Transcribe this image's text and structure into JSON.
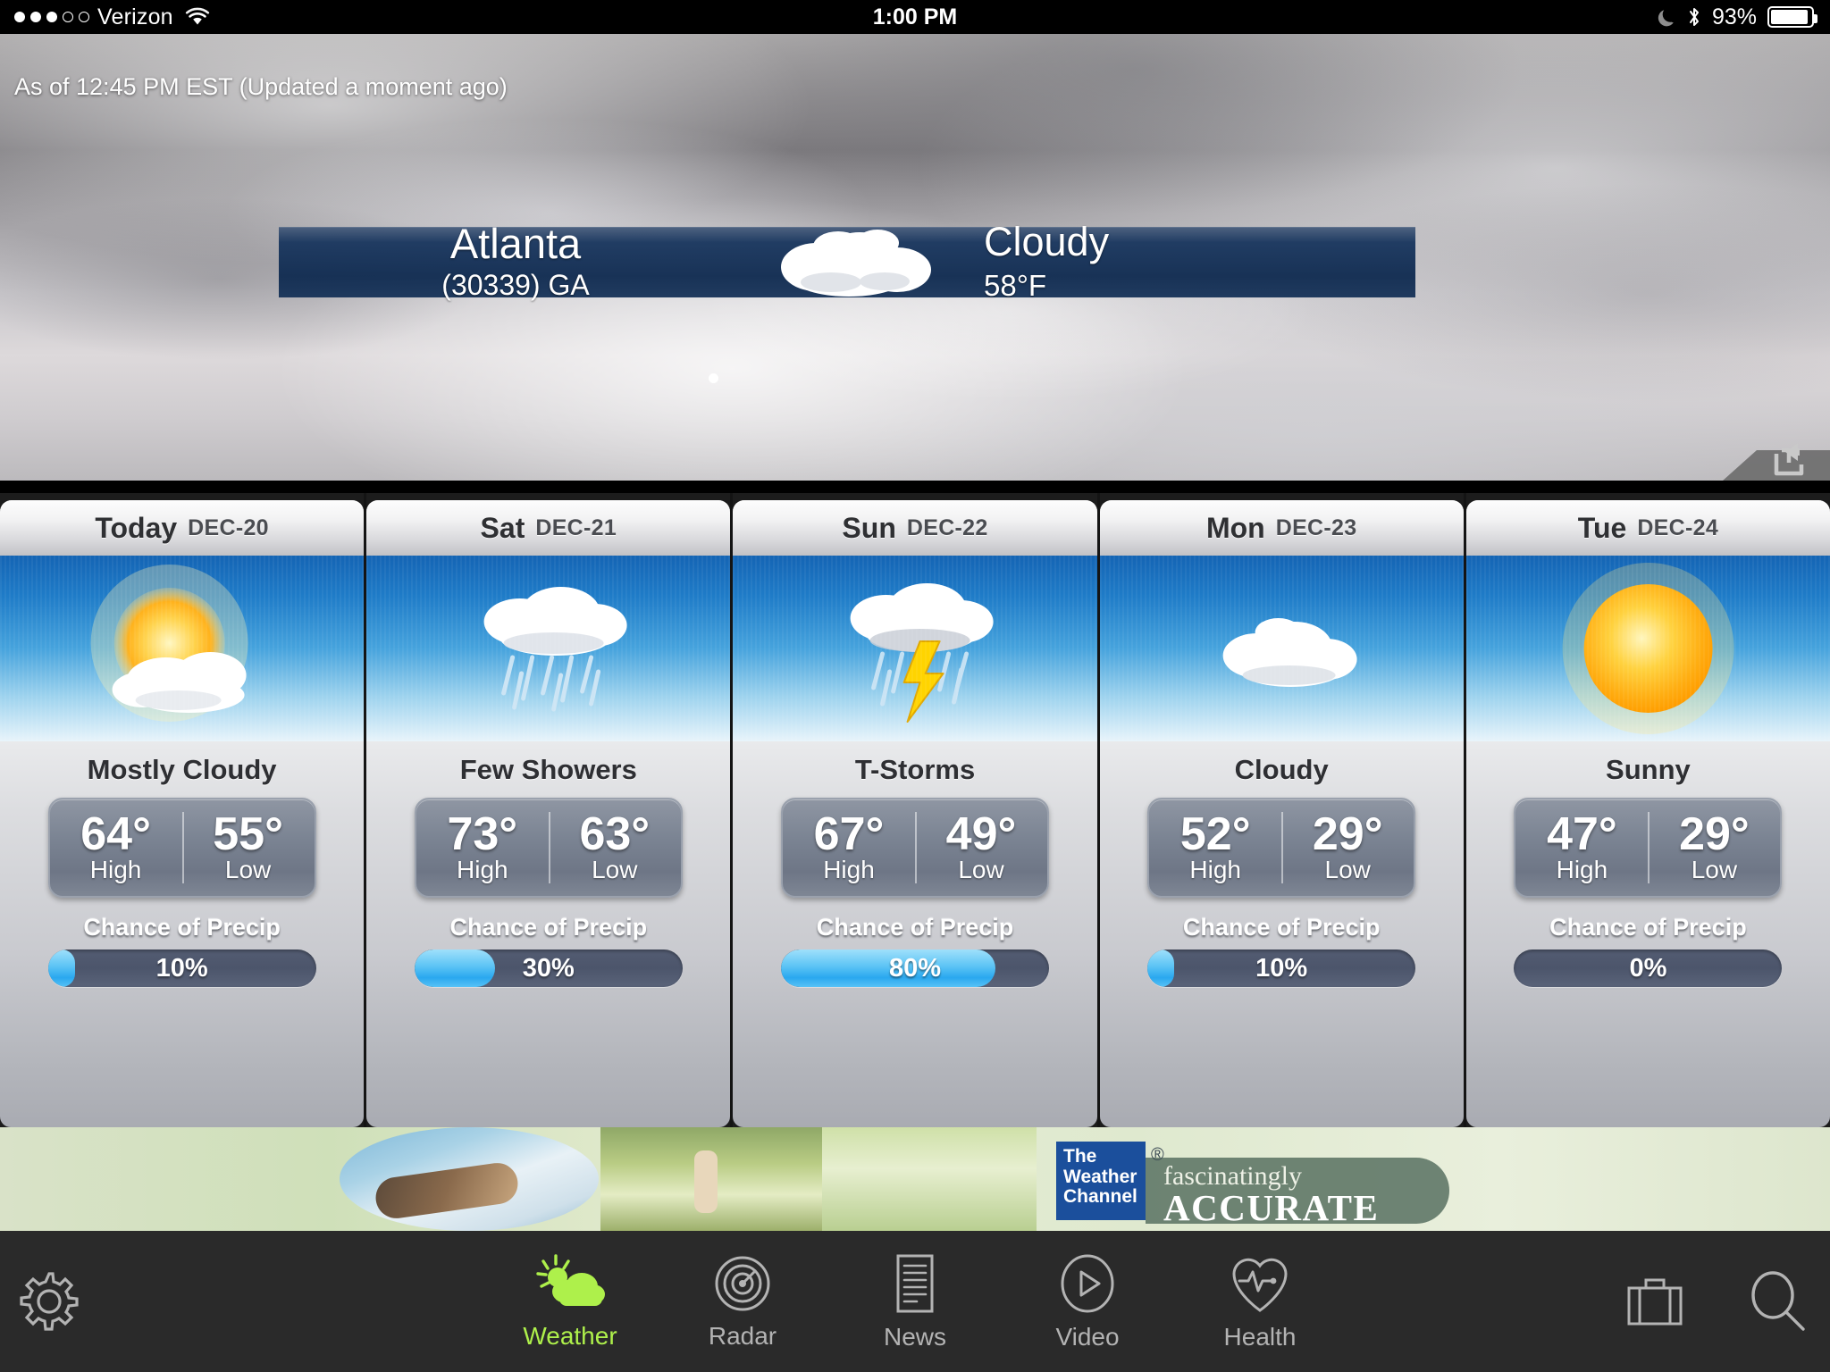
{
  "status_bar": {
    "signal_dots_filled": 3,
    "signal_dots_empty": 2,
    "carrier": "Verizon",
    "wifi_icon": "wifi-icon",
    "time": "1:00 PM",
    "dnd_icon": "moon-icon",
    "bluetooth_icon": "bluetooth-icon",
    "battery_percent": "93%",
    "battery_level": 93
  },
  "hero": {
    "as_of": "As of 12:45 PM EST (Updated a moment ago)",
    "condition_icon": "cloudy-icon",
    "share_icon": "share-icon",
    "page_indicator_dots": 1,
    "location": {
      "city": "Atlanta",
      "zip_state": "(30339) GA",
      "condition": "Cloudy",
      "temperature": "58°F"
    }
  },
  "forecast": {
    "days": [
      {
        "name": "Today",
        "date": "DEC-20",
        "icon": "partly-sunny-icon",
        "condition": "Mostly Cloudy",
        "high": "64°",
        "low": "55°",
        "high_label": "High",
        "low_label": "Low",
        "precip_label": "Chance of Precip",
        "precip": "10%",
        "precip_value": 10
      },
      {
        "name": "Sat",
        "date": "DEC-21",
        "icon": "showers-icon",
        "condition": "Few Showers",
        "high": "73°",
        "low": "63°",
        "high_label": "High",
        "low_label": "Low",
        "precip_label": "Chance of Precip",
        "precip": "30%",
        "precip_value": 30
      },
      {
        "name": "Sun",
        "date": "DEC-22",
        "icon": "thunderstorm-icon",
        "condition": "T-Storms",
        "high": "67°",
        "low": "49°",
        "high_label": "High",
        "low_label": "Low",
        "precip_label": "Chance of Precip",
        "precip": "80%",
        "precip_value": 80
      },
      {
        "name": "Mon",
        "date": "DEC-23",
        "icon": "cloudy-icon",
        "condition": "Cloudy",
        "high": "52°",
        "low": "29°",
        "high_label": "High",
        "low_label": "Low",
        "precip_label": "Chance of Precip",
        "precip": "10%",
        "precip_value": 10
      },
      {
        "name": "Tue",
        "date": "DEC-24",
        "icon": "sunny-icon",
        "condition": "Sunny",
        "high": "47°",
        "low": "29°",
        "high_label": "High",
        "low_label": "Low",
        "precip_label": "Chance of Precip",
        "precip": "0%",
        "precip_value": 0
      }
    ]
  },
  "ad": {
    "brand_line1": "The",
    "brand_line2": "Weather",
    "brand_line3": "Channel",
    "registered_mark": "®",
    "tagline_top": "fascinatingly",
    "tagline_bottom": "ACCURATE"
  },
  "tab_bar": {
    "settings_icon": "gear-icon",
    "items": [
      {
        "label": "Weather",
        "icon": "sun-cloud-icon",
        "active": true
      },
      {
        "label": "Radar",
        "icon": "radar-target-icon",
        "active": false
      },
      {
        "label": "News",
        "icon": "document-icon",
        "active": false
      },
      {
        "label": "Video",
        "icon": "play-circle-icon",
        "active": false
      },
      {
        "label": "Health",
        "icon": "heart-pulse-icon",
        "active": false
      }
    ],
    "travel_icon": "briefcase-icon",
    "search_icon": "search-icon"
  },
  "colors": {
    "accent_green": "#aef04b",
    "banner_blue": "#12325a",
    "precip_fill": "#2aa8ef",
    "tabbar_bg": "#2a2a2a"
  }
}
